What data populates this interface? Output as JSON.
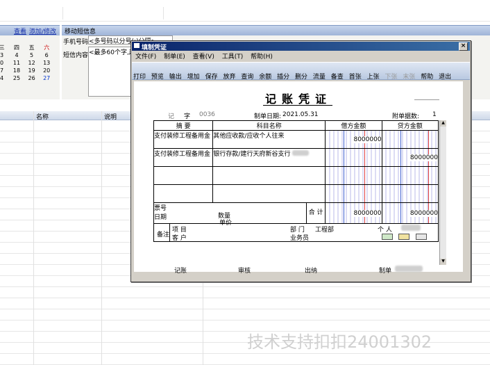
{
  "left_panel": {
    "links": [
      "查看",
      "添加/修改"
    ],
    "calendar_headers": [
      "三",
      "四",
      "五",
      "六"
    ],
    "calendar_rows": [
      [
        "",
        "",
        "",
        ""
      ],
      [
        "3",
        "4",
        "5",
        "6"
      ],
      [
        "0",
        "11",
        "12",
        "13"
      ],
      [
        "7",
        "18",
        "19",
        "20"
      ],
      [
        "4",
        "25",
        "26",
        "27"
      ]
    ]
  },
  "sms_panel": {
    "title": "移动短信息",
    "phone_label": "手机号码",
    "phone_placeholder": "<多号码以分号(;)分隔>",
    "content_label": "短信内容",
    "content_placeholder": "<最多60个字,超"
  },
  "grid": {
    "columns": [
      "名称",
      "说明"
    ]
  },
  "dialog": {
    "title": "填制凭证",
    "close": "×",
    "menu": [
      "文件(F)",
      "制单(E)",
      "查看(V)",
      "工具(T)",
      "帮助(H)"
    ],
    "toolbar": [
      "打印",
      "预览",
      "输出",
      "增加",
      "保存",
      "放弃",
      "查询",
      "余额",
      "插分",
      "删分",
      "流量",
      "备查",
      "首张",
      "上张",
      "下张",
      "末张",
      "帮助",
      "退出"
    ],
    "toolbar_disabled": [
      "下张",
      "末张"
    ],
    "voucher": {
      "heading": "记账凭证",
      "type_label": "记",
      "type_word": "字",
      "number": "0036",
      "date_label": "制单日期:",
      "date": "2021.05.31",
      "attach_label": "附单据数:",
      "attach_value": "1",
      "col_summary": "摘 要",
      "col_account": "科目名称",
      "col_debit": "借方金额",
      "col_credit": "贷方金额",
      "entries": [
        {
          "summary": "支付装修工程备用金",
          "account": "其他应收款/应收个人往来",
          "debit": "8000000",
          "credit": ""
        },
        {
          "summary": "支付装修工程备用金",
          "account": "银行存款/建行天府新谷支行",
          "debit": "",
          "credit": "8000000"
        }
      ],
      "bill_no_label": "票号",
      "date_row_label": "日期",
      "qty_label": "数量",
      "price_label": "单价",
      "total_label": "合 计",
      "total_debit": "8000000",
      "total_credit": "8000000",
      "remark_label": "备注",
      "project_label": "项 目",
      "customer_label": "客 户",
      "dept_label": "部 门",
      "dept_value": "工程部",
      "person_label": "个 人",
      "salesman_label": "业务员",
      "footer": [
        "记账",
        "审核",
        "出纳",
        "制单"
      ]
    }
  },
  "watermark": "技术支持扣扣24001302"
}
